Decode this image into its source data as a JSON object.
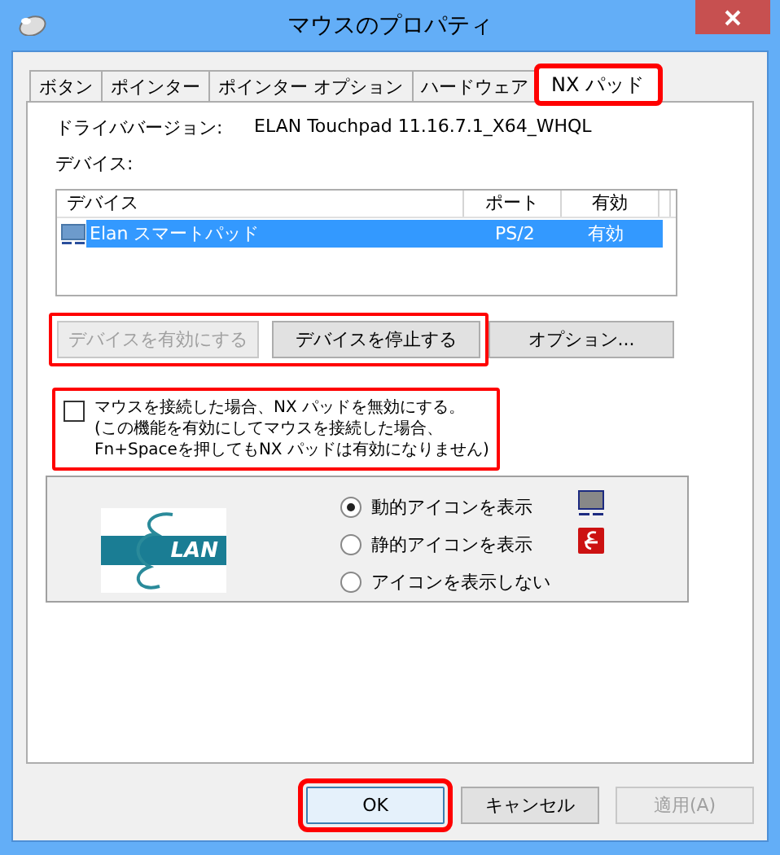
{
  "window": {
    "title": "マウスのプロパティ"
  },
  "tabs": [
    {
      "label": "ボタン",
      "selected": false,
      "highlighted": false
    },
    {
      "label": "ポインター",
      "selected": false,
      "highlighted": false
    },
    {
      "label": "ポインター オプション",
      "selected": false,
      "highlighted": false
    },
    {
      "label": "ハードウェア",
      "selected": false,
      "highlighted": false
    },
    {
      "label": "NX パッド",
      "selected": true,
      "highlighted": true
    }
  ],
  "driver": {
    "label": "ドライババージョン:",
    "value": "ELAN Touchpad 11.16.7.1_X64_WHQL"
  },
  "devices": {
    "label": "デバイス:",
    "columns": [
      "デバイス",
      "ポート",
      "有効"
    ],
    "rows": [
      {
        "cells": [
          "Elan スマートパッド",
          "PS/2",
          "有効"
        ],
        "selected": true
      }
    ]
  },
  "device_buttons": {
    "highlighted": true,
    "items": [
      {
        "label": "デバイスを有効にする",
        "disabled": true
      },
      {
        "label": "デバイスを停止する",
        "disabled": false
      }
    ]
  },
  "options_button": {
    "label": "オプション..."
  },
  "disable_option": {
    "checked": false,
    "highlighted": true,
    "lines": [
      "マウスを接続した場合、NX パッドを無効にする。",
      "(この機能を有効にしてマウスを接続した場合、",
      "Fn+Spaceを押してもNX パッドは有効になりません)"
    ]
  },
  "logo": {
    "text": "LAN"
  },
  "icon_options": [
    {
      "label": "動的アイコンを表示",
      "selected": true,
      "kind": "touchpad"
    },
    {
      "label": "静的アイコンを表示",
      "selected": false,
      "kind": "logo"
    },
    {
      "label": "アイコンを表示しない",
      "selected": false,
      "kind": "plain"
    }
  ],
  "footer_buttons": [
    {
      "label": "OK",
      "disabled": false,
      "highlighted": true,
      "default": true
    },
    {
      "label": "キャンセル",
      "disabled": false,
      "highlighted": false,
      "default": false
    },
    {
      "label": "適用(A)",
      "disabled": true,
      "highlighted": false,
      "default": false
    }
  ]
}
